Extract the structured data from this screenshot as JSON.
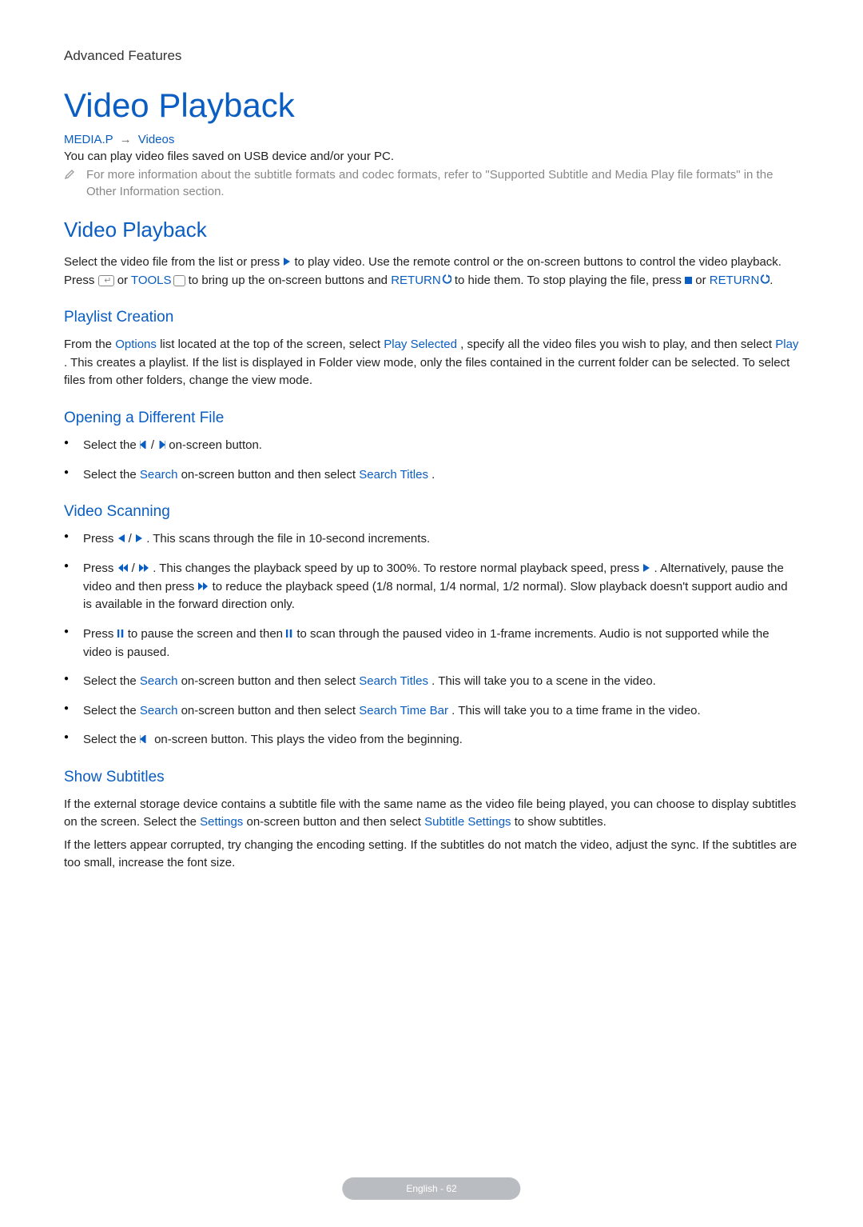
{
  "breadcrumb": "Advanced Features",
  "page_title": "Video Playback",
  "nav_path": {
    "item1": "MEDIA.P",
    "item2": "Videos"
  },
  "intro": "You can play video files saved on USB device and/or your PC.",
  "note": "For more information about the subtitle formats and codec formats, refer to \"Supported Subtitle and Media Play file formats\" in the Other Information section.",
  "sections": {
    "video_playback": {
      "title": "Video Playback",
      "p1_a": "Select the video file from the list or press ",
      "p1_b": " to play video. Use the remote control or the on-screen buttons to control the video playback. Press ",
      "p1_c": " or ",
      "p1_tools": "TOOLS",
      "p1_d": " to bring up the on-screen buttons and ",
      "p1_return1": "RETURN",
      "p1_e": " to hide them. To stop playing the file, press ",
      "p1_f": " or ",
      "p1_return2": "RETURN",
      "p1_g": "."
    },
    "playlist": {
      "title": "Playlist Creation",
      "p1_a": "From the ",
      "p1_options": "Options",
      "p1_b": " list located at the top of the screen, select ",
      "p1_play_selected": "Play Selected",
      "p1_c": ", specify all the video files you wish to play, and then select ",
      "p1_play": "Play",
      "p1_d": ". This creates a playlist. If the list is displayed in Folder view mode, only the files contained in the current folder can be selected. To select files from other folders, change the view mode."
    },
    "opening": {
      "title": "Opening a Different File",
      "b1_a": "Select the ",
      "b1_b": " on-screen button.",
      "b2_a": "Select the ",
      "b2_search": "Search",
      "b2_b": " on-screen button and then select ",
      "b2_titles": "Search Titles",
      "b2_c": "."
    },
    "scanning": {
      "title": "Video Scanning",
      "b1_a": "Press ",
      "b1_b": ". This scans through the file in 10-second increments.",
      "b2_a": "Press ",
      "b2_b": ". This changes the playback speed by up to 300%. To restore normal playback speed, press ",
      "b2_c": ". Alternatively, pause the video and then press ",
      "b2_d": " to reduce the playback speed (1/8 normal, 1/4 normal, 1/2 normal). Slow playback doesn't support audio and is available in the forward direction only.",
      "b3_a": "Press ",
      "b3_b": " to pause the screen and then ",
      "b3_c": " to scan through the paused video in 1-frame increments. Audio is not supported while the video is paused.",
      "b4_a": "Select the ",
      "b4_search": "Search",
      "b4_b": " on-screen button and then select ",
      "b4_titles": "Search Titles",
      "b4_c": ". This will take you to a scene in the video.",
      "b5_a": "Select the ",
      "b5_search": "Search",
      "b5_b": " on-screen button and then select ",
      "b5_timebar": "Search Time Bar",
      "b5_c": ". This will take you to a time frame in the video.",
      "b6_a": "Select the ",
      "b6_b": " on-screen button. This plays the video from the beginning."
    },
    "subtitles": {
      "title": "Show Subtitles",
      "p1_a": "If the external storage device contains a subtitle file with the same name as the video file being played, you can choose to display subtitles on the screen. Select the ",
      "p1_settings": "Settings",
      "p1_b": " on-screen button and then select ",
      "p1_sub_settings": "Subtitle Settings",
      "p1_c": " to show subtitles.",
      "p2": "If the letters appear corrupted, try changing the encoding setting. If the subtitles do not match the video, adjust the sync. If the subtitles are too small, increase the font size."
    }
  },
  "footer": "English - 62"
}
